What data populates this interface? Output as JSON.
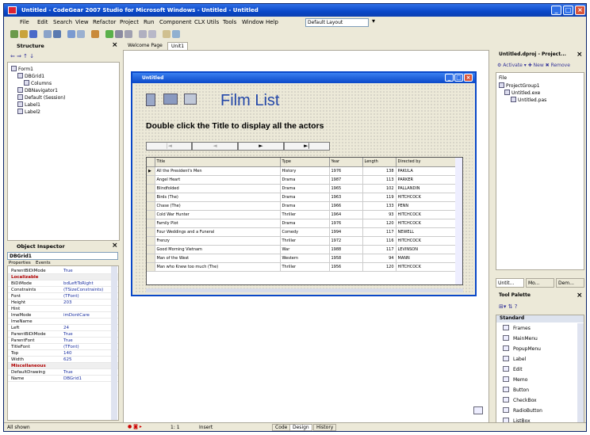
{
  "window": {
    "title": "Untitled - CodeGear 2007 Studio for Microsoft Windows - Untitled - Untitled",
    "buttons": [
      "minimize",
      "maximize",
      "close"
    ]
  },
  "menubar": {
    "items": [
      "File",
      "Edit",
      "Search",
      "View",
      "Refactor",
      "Project",
      "Run",
      "Component",
      "CLX Utils",
      "Tools",
      "Window",
      "Help"
    ],
    "layout_combo": "Default Layout"
  },
  "structure": {
    "title": "Structure",
    "tree": [
      "Form1",
      "DBGrid1",
      "Columns",
      "DBNavigator1",
      "Default (Session)",
      "Label1",
      "Label2"
    ]
  },
  "designer_tabs": [
    "Welcome Page",
    "Unit1"
  ],
  "form": {
    "title": "Untitled",
    "heading": "Film List",
    "instruction": "Double click the Title to display all the actors",
    "nav_buttons": [
      "|◄",
      "◄",
      "►",
      "►|"
    ],
    "grid": {
      "columns": [
        "Title",
        "Type",
        "Year",
        "Length",
        "Directed by"
      ],
      "rows": [
        [
          "All the President's Men",
          "History",
          "1976",
          "138",
          "PAKULA"
        ],
        [
          "Angel Heart",
          "Drama",
          "1987",
          "113",
          "PARKER"
        ],
        [
          "Blindfolded",
          "Drama",
          "1965",
          "102",
          "PALLANDIN"
        ],
        [
          "Birds (The)",
          "Drama",
          "1963",
          "119",
          "HITCHCOCK"
        ],
        [
          "Chase (The)",
          "Drama",
          "1966",
          "133",
          "PENN"
        ],
        [
          "Cold War Hunter",
          "Thriller",
          "1964",
          "93",
          "HITCHCOCK"
        ],
        [
          "Family Plot",
          "Drama",
          "1976",
          "120",
          "HITCHCOCK"
        ],
        [
          "Four Weddings and a Funeral",
          "Comedy",
          "1994",
          "117",
          "NEWELL"
        ],
        [
          "Frenzy",
          "Thriller",
          "1972",
          "116",
          "HITCHCOCK"
        ],
        [
          "Good Morning Vietnam",
          "War",
          "1988",
          "117",
          "LEVINSON"
        ],
        [
          "Man of the West",
          "Western",
          "1958",
          "94",
          "MANN"
        ],
        [
          "Man who Knew too much (The)",
          "Thriller",
          "1956",
          "120",
          "HITCHCOCK"
        ]
      ]
    }
  },
  "inspector": {
    "title": "Object Inspector",
    "selected": "DBGrid1",
    "tabs": [
      "Properties",
      "Events"
    ],
    "rows": [
      {
        "k": "ParentBiDiMode",
        "v": "True"
      },
      {
        "k": "Localizable",
        "v": "",
        "cat": true
      },
      {
        "k": "BiDiMode",
        "v": "bdLeftToRight"
      },
      {
        "k": "Constraints",
        "v": "(TSizeConstraints)"
      },
      {
        "k": "Font",
        "v": "(TFont)"
      },
      {
        "k": "Height",
        "v": "203"
      },
      {
        "k": "Hint",
        "v": ""
      },
      {
        "k": "ImeMode",
        "v": "imDontCare"
      },
      {
        "k": "ImeName",
        "v": ""
      },
      {
        "k": "Left",
        "v": "24"
      },
      {
        "k": "ParentBiDiMode",
        "v": "True"
      },
      {
        "k": "ParentFont",
        "v": "True"
      },
      {
        "k": "TitleFont",
        "v": "(TFont)"
      },
      {
        "k": "Top",
        "v": "140"
      },
      {
        "k": "Width",
        "v": "625"
      },
      {
        "k": "Miscellaneous",
        "v": "",
        "cat": true
      },
      {
        "k": "DefaultDrawing",
        "v": "True"
      },
      {
        "k": "Name",
        "v": "DBGrid1"
      }
    ],
    "status": "All shown"
  },
  "project": {
    "title": "Untitled.dproj - Project...",
    "tree": [
      "File",
      "ProjectGroup1",
      "Untitled.exe",
      "Untitled.pas"
    ]
  },
  "right_tabs": [
    "Untit...",
    "Mo...",
    "Dem..."
  ],
  "palette": {
    "title": "Tool Palette",
    "category": "Standard",
    "items": [
      "Frames",
      "MainMenu",
      "PopupMenu",
      "Label",
      "Edit",
      "Memo",
      "Button",
      "CheckBox",
      "RadioButton",
      "ListBox"
    ]
  },
  "status": {
    "position": "1: 1",
    "mode": "Insert",
    "bottom_tabs": [
      "Code",
      "Design",
      "History"
    ]
  }
}
